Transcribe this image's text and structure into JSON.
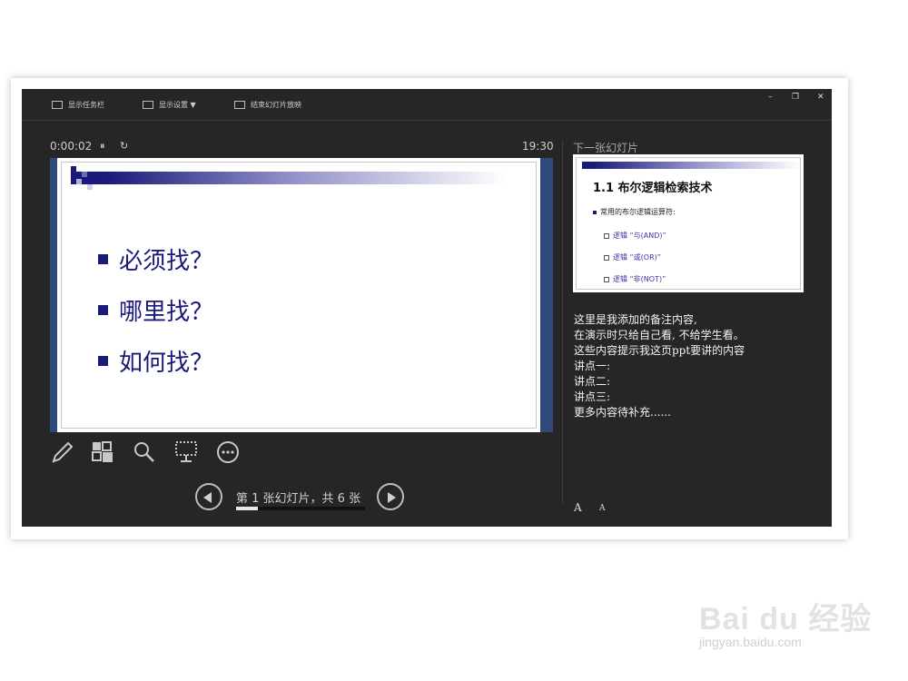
{
  "toolbar": {
    "show_taskbar": "显示任务栏",
    "display_settings": "显示设置 ▼",
    "end_show": "结束幻灯片放映"
  },
  "window_controls": {
    "minimize": "–",
    "restore": "❐",
    "close": "✕"
  },
  "timer": {
    "elapsed": "0:00:02",
    "pause_icon": "⏸",
    "reset_icon": "↻"
  },
  "clock": "19:30",
  "next_slide_label": "下一张幻灯片",
  "current_slide": {
    "bullets": [
      "必须找？",
      "哪里找？",
      "如何找？"
    ]
  },
  "next_slide": {
    "title": "1.1 布尔逻辑检索技术",
    "bullet": "常用的布尔逻辑运算符:",
    "subitems": [
      "逻辑 “与(AND)”",
      "逻辑 “或(OR)”",
      "逻辑 “非(NOT)”"
    ]
  },
  "notes": [
    "这里是我添加的备注内容,",
    "在演示时只给自己看, 不给学生看。",
    "这些内容提示我这页ppt要讲的内容",
    "讲点一:",
    "讲点二:",
    "讲点三:",
    "更多内容待补充......"
  ],
  "navigation": {
    "counter": "第 1 张幻灯片，共 6 张",
    "progress_fraction": 0.1667
  },
  "font_buttons": {
    "increase": "A",
    "decrease": "A"
  },
  "watermark": {
    "logo": "Bai du 经验",
    "url": "jingyan.baidu.com"
  },
  "colors": {
    "window_bg": "#262626",
    "slide_accent": "#1a1a7a"
  }
}
